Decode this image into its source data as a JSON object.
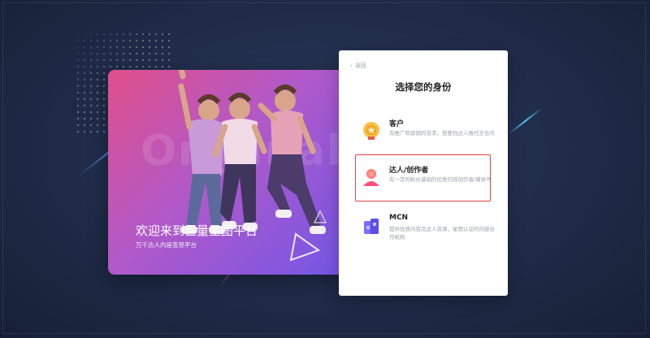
{
  "banner": {
    "watermark": "Originality",
    "title": "欢迎来到巨量星图平台",
    "subtitle": "万千达人内容变现平台"
  },
  "card": {
    "back_label": "返回",
    "title": "选择您的身份",
    "options": [
      {
        "name": "客户",
        "description": "有推广和营销的诉求，想要找达人做代言合作",
        "icon": "medal-icon",
        "color": "#f5b52e"
      },
      {
        "name": "达人/创作者",
        "description": "有一定的粉丝基础的优质内容创作者/媒体号",
        "icon": "person-icon",
        "color": "#ff5a6e",
        "selected": true
      },
      {
        "name": "MCN",
        "description": "提供优质内容及达人资源，星图认证的内容合作机构",
        "icon": "building-icon",
        "color": "#6a5cff"
      }
    ]
  },
  "colors": {
    "selected_border": "#e0473f",
    "banner_start": "#e04f89",
    "banner_end": "#7156e6"
  }
}
